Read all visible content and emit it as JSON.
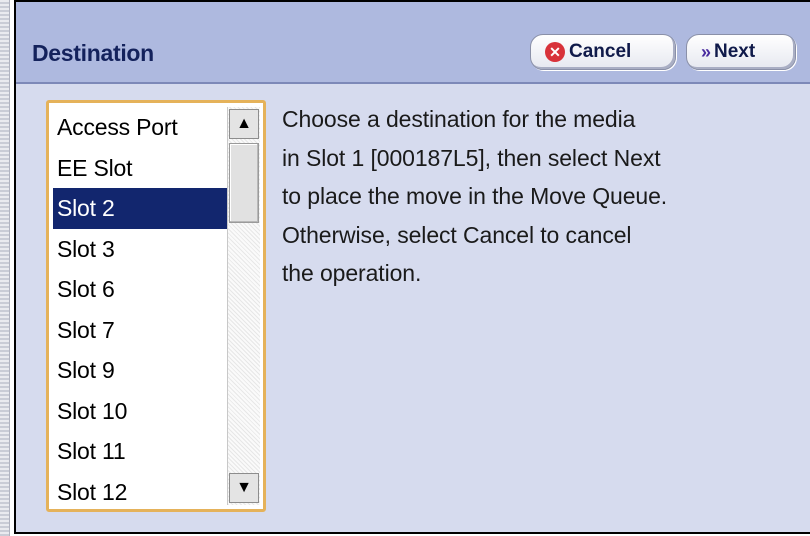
{
  "header": {
    "title": "Destination",
    "cancel_label": "Cancel",
    "next_label": "Next"
  },
  "destination_list": {
    "items": [
      "Access Port",
      "EE Slot",
      "Slot 2",
      "Slot 3",
      "Slot 6",
      "Slot 7",
      "Slot 9",
      "Slot 10",
      "Slot 11",
      "Slot 12"
    ],
    "selected": "Slot 2"
  },
  "message": {
    "line1": "Choose a destination for the media",
    "line2": "in Slot 1 [000187L5], then select Next",
    "line3": "to place the move in the Move Queue.",
    "line4": "Otherwise, select Cancel to cancel",
    "line5": "the operation."
  },
  "icons": {
    "cancel": "cancel-circle-icon",
    "next": "double-chevron-right-icon",
    "scroll_up": "triangle-up-icon",
    "scroll_down": "triangle-down-icon"
  },
  "colors": {
    "header_bg": "#aeb9df",
    "panel_bg": "#d6dbee",
    "selection": "#12266e",
    "list_border": "#e5b25a",
    "cancel_icon": "#d8323a",
    "next_icon": "#4a2ca0"
  }
}
